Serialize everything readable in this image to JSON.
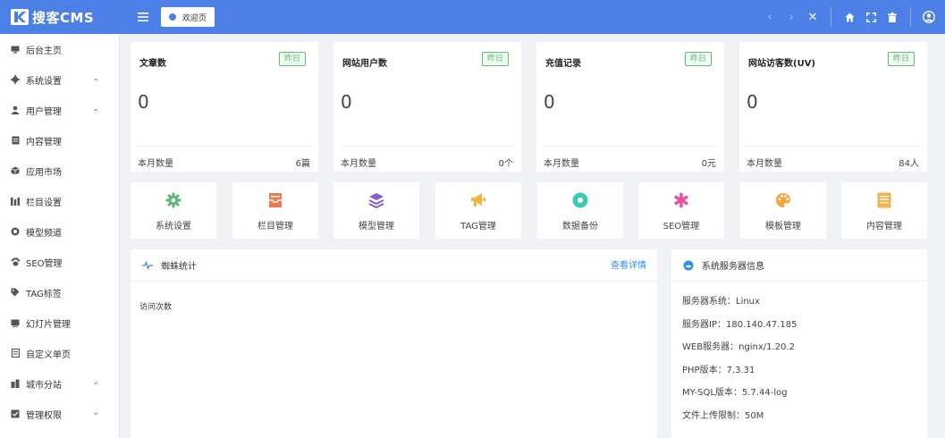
{
  "brand": {
    "name": "搜客CMS"
  },
  "header": {
    "welcome_tab": "欢迎页"
  },
  "sidebar": {
    "items": [
      {
        "label": "后台主页",
        "icon": "monitor-icon",
        "expandable": false
      },
      {
        "label": "系统设置",
        "icon": "gear-icon",
        "expandable": true
      },
      {
        "label": "用户管理",
        "icon": "user-icon",
        "expandable": true
      },
      {
        "label": "内容管理",
        "icon": "file-icon",
        "expandable": false
      },
      {
        "label": "应用市场",
        "icon": "cube-icon",
        "expandable": false
      },
      {
        "label": "栏目设置",
        "icon": "columns-icon",
        "expandable": false
      },
      {
        "label": "模型频道",
        "icon": "model-icon",
        "expandable": false
      },
      {
        "label": "SEO管理",
        "icon": "paw-icon",
        "expandable": false
      },
      {
        "label": "TAG标签",
        "icon": "tag-icon",
        "expandable": false
      },
      {
        "label": "幻灯片管理",
        "icon": "slides-icon",
        "expandable": false
      },
      {
        "label": "自定义单页",
        "icon": "page-icon",
        "expandable": false
      },
      {
        "label": "城市分站",
        "icon": "city-icon",
        "expandable": true
      },
      {
        "label": "管理权限",
        "icon": "permission-icon",
        "expandable": true
      }
    ]
  },
  "stats": [
    {
      "title": "文章数",
      "badge": "昨日",
      "value": "0",
      "foot_label": "本月数量",
      "foot_value": "6篇"
    },
    {
      "title": "网站用户数",
      "badge": "昨日",
      "value": "0",
      "foot_label": "本月数量",
      "foot_value": "0个"
    },
    {
      "title": "充值记录",
      "badge": "昨日",
      "value": "0",
      "foot_label": "本月数量",
      "foot_value": "0元"
    },
    {
      "title": "网站访客数(UV)",
      "badge": "昨日",
      "value": "0",
      "foot_label": "本月数量",
      "foot_value": "84人"
    }
  ],
  "shortcuts": [
    {
      "label": "系统设置",
      "icon": "gear-icon",
      "color": "#5fb878"
    },
    {
      "label": "栏目管理",
      "icon": "inbox-icon",
      "color": "#ee7a4c"
    },
    {
      "label": "模型管理",
      "icon": "layers-icon",
      "color": "#8a5cd6"
    },
    {
      "label": "TAG管理",
      "icon": "megaphone-icon",
      "color": "#f7b23b"
    },
    {
      "label": "数据备份",
      "icon": "disc-icon",
      "color": "#3fc8b6"
    },
    {
      "label": "SEO管理",
      "icon": "asterisk-icon",
      "color": "#e84f9c"
    },
    {
      "label": "模板管理",
      "icon": "palette-icon",
      "color": "#f2a73b"
    },
    {
      "label": "内容管理",
      "icon": "document-icon",
      "color": "#f2b24c"
    }
  ],
  "spider_panel": {
    "title": "蜘蛛统计",
    "link": "查看详情",
    "visit_label": "访问次数"
  },
  "server_panel": {
    "title": "系统服务器信息",
    "rows": [
      "服务器系统：Linux",
      "服务器IP：180.140.47.185",
      "WEB服务器：nginx/1.20.2",
      "PHP版本：7.3.31",
      "MY-SQL版本：5.7.44-log",
      "文件上传限制：50M"
    ]
  },
  "colors": {
    "primary": "#4c80e6",
    "badge": "#5fb878",
    "link": "#2c8df0"
  }
}
